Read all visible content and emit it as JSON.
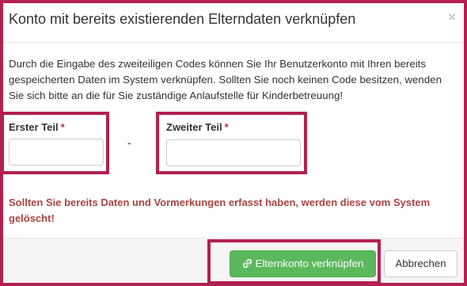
{
  "dialog": {
    "title": "Konto mit bereits existierenden Elterndaten verknüpfen",
    "close_symbol": "×",
    "description": "Durch die Eingabe des zweiteiligen Codes können Sie Ihr Benutzerkonto mit Ihren bereits gespeicherten Daten im System verknüpfen. Sollten Sie noch keinen Code besitzen, wenden Sie sich bitte an die für Sie zuständige Anlaufstelle für Kinderbetreuung!",
    "warning": "Sollten Sie bereits Daten und Vormerkungen erfasst haben, werden diese vom System gelöscht!"
  },
  "form": {
    "first_part": {
      "label": "Erster Teil",
      "required_mark": "*",
      "value": ""
    },
    "separator": "-",
    "second_part": {
      "label": "Zweiter Teil",
      "required_mark": "*",
      "value": ""
    }
  },
  "footer": {
    "link_button": {
      "label": "Elternkonto verknüpfen",
      "icon": "link-icon"
    },
    "cancel_button": {
      "label": "Abbrechen"
    }
  },
  "colors": {
    "highlight": "#b3204f",
    "warning": "#a94442",
    "required": "#c7254e",
    "success": "#5cb85c"
  }
}
